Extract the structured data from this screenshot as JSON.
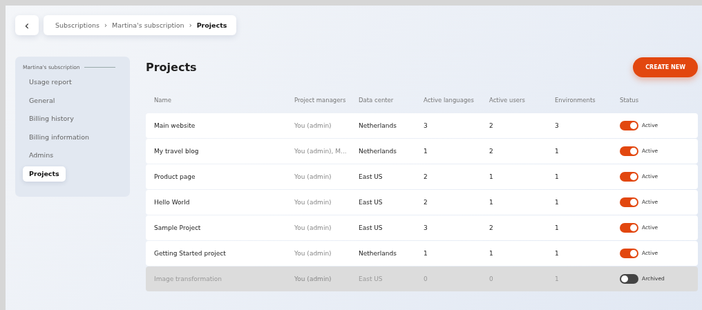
{
  "breadcrumb": {
    "back": "‹",
    "items": [
      {
        "label": "Subscriptions",
        "selected": false
      },
      {
        "label": "Martina's subscription",
        "selected": false
      },
      {
        "label": "Projects",
        "selected": true
      }
    ],
    "separator": "›"
  },
  "sidebar": {
    "heading": "Martina's subscription",
    "items": [
      {
        "label": "Usage report",
        "selected": false
      },
      {
        "label": "General",
        "selected": false
      },
      {
        "label": "Billing history",
        "selected": false
      },
      {
        "label": "Billing information",
        "selected": false
      },
      {
        "label": "Admins",
        "selected": false
      },
      {
        "label": "Projects",
        "selected": true
      }
    ]
  },
  "page_title": "Projects",
  "create_button": "CREATE NEW",
  "table": {
    "columns": [
      "Name",
      "Project managers",
      "Data center",
      "Active languages",
      "Active users",
      "Environments",
      "Status"
    ],
    "rows": [
      {
        "name": "Main website",
        "managers": "You (admin)",
        "data_center": "Netherlands",
        "languages": "3",
        "users": "2",
        "environments": "3",
        "on": true,
        "status": "Active"
      },
      {
        "name": "My travel blog",
        "managers": "You (admin), M...",
        "data_center": "Netherlands",
        "languages": "1",
        "users": "2",
        "environments": "1",
        "on": true,
        "status": "Active"
      },
      {
        "name": "Product page",
        "managers": "You (admin)",
        "data_center": "East US",
        "languages": "2",
        "users": "1",
        "environments": "1",
        "on": true,
        "status": "Active"
      },
      {
        "name": "Hello World",
        "managers": "You (admin)",
        "data_center": "East US",
        "languages": "2",
        "users": "1",
        "environments": "1",
        "on": true,
        "status": "Active"
      },
      {
        "name": "Sample Project",
        "managers": "You (admin)",
        "data_center": "East US",
        "languages": "3",
        "users": "2",
        "environments": "1",
        "on": true,
        "status": "Active"
      },
      {
        "name": "Getting Started project",
        "managers": "You (admin)",
        "data_center": "Netherlands",
        "languages": "1",
        "users": "1",
        "environments": "1",
        "on": true,
        "status": "Active"
      },
      {
        "name": "Image transformation",
        "managers": "You (admin)",
        "data_center": "East US",
        "languages": "0",
        "users": "0",
        "environments": "1",
        "on": false,
        "status": "Archived"
      }
    ]
  }
}
